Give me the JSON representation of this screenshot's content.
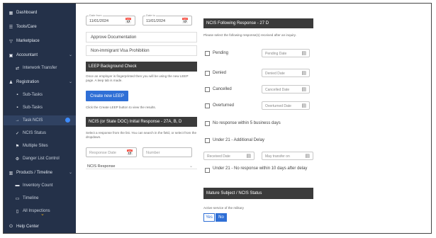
{
  "sidebar": {
    "items": [
      {
        "icon": "dashboard-icon",
        "glyph": "▦",
        "label": "Dashboard"
      },
      {
        "icon": "list-icon",
        "glyph": "☰",
        "label": "Tools/Care"
      },
      {
        "icon": "filter-icon",
        "glyph": "▽",
        "label": "Marketplace"
      },
      {
        "icon": "bank-icon",
        "glyph": "▣",
        "label": "Accountant"
      },
      {
        "icon": "transfer-icon",
        "glyph": "⇄",
        "label": "Interwork Transfer"
      },
      {
        "icon": "people-icon",
        "glyph": "♟",
        "label": "Registration"
      },
      {
        "icon": "doc-icon",
        "glyph": "▪",
        "label": "Sub-Tasks"
      },
      {
        "icon": "doc-icon",
        "glyph": "▪",
        "label": "Sub-Tasks"
      },
      {
        "icon": "arrow-icon",
        "glyph": "→",
        "label": "Task NCIS"
      },
      {
        "icon": "check-icon",
        "glyph": "✓",
        "label": "NCIS Status"
      },
      {
        "icon": "flag-icon",
        "glyph": "⚑",
        "label": "Multiple Sites"
      },
      {
        "icon": "gear-icon",
        "glyph": "⚙",
        "label": "Danger List Control"
      },
      {
        "icon": "grid-icon",
        "glyph": "▥",
        "label": "Products / Timeline"
      },
      {
        "icon": "card-icon",
        "glyph": "▬",
        "label": "Inventory Count"
      },
      {
        "icon": "clock-icon",
        "glyph": "▭",
        "label": "Timeline"
      },
      {
        "icon": "file-icon",
        "glyph": "▯",
        "label": "All Inspections"
      },
      {
        "icon": "power-icon",
        "glyph": "⏻",
        "label": "Help Center"
      }
    ]
  },
  "left": {
    "date_from": {
      "label": "Date from",
      "value": "11/01/2024"
    },
    "date_to": {
      "label": "Date to",
      "value": "11/01/2024"
    },
    "check1": "Approve Documentation",
    "check2": "Non-immigrant Visa Prohibition",
    "leep_head": "LEEP Background Check",
    "leep_note": "Once an employer is fingerprinted then you will be using the new LEEP page. A leep tab is made.",
    "leep_button": "Create new LEEP",
    "leep_note2": "Click the Create LEEP button to view the results.",
    "ncis_head": "NCIS (or State DOC) Initial Response - 27A, B, D",
    "ncis_note": "Select a response from the list. You can search in the field, or select from the dropdown.",
    "resp_date": "Response Date",
    "number": "Number",
    "ncis_resp": "NCIS Response"
  },
  "right": {
    "head": "NCIS Following Response - 27 D",
    "note": "Please select the following response(s) received after an inquiry.",
    "rows": [
      {
        "label": "Pending",
        "select": "Pending Date"
      },
      {
        "label": "Denied",
        "select": "Denied Date"
      },
      {
        "label": "Cancelled",
        "select": "Cancelled Date"
      },
      {
        "label": "Overturned",
        "select": "Overturned Date"
      }
    ],
    "no_resp": "No response within 5 business days",
    "under21": "Under 21 - Additional Delay",
    "received": "Received Date",
    "may_transfer": "May transfer on",
    "under21_no": "Under 21 - No response within 10 days after delay",
    "mature_head": "Mature Subject / NCIS Status",
    "active_label": "Active service of the military",
    "yes": "Yes",
    "no": "No"
  }
}
